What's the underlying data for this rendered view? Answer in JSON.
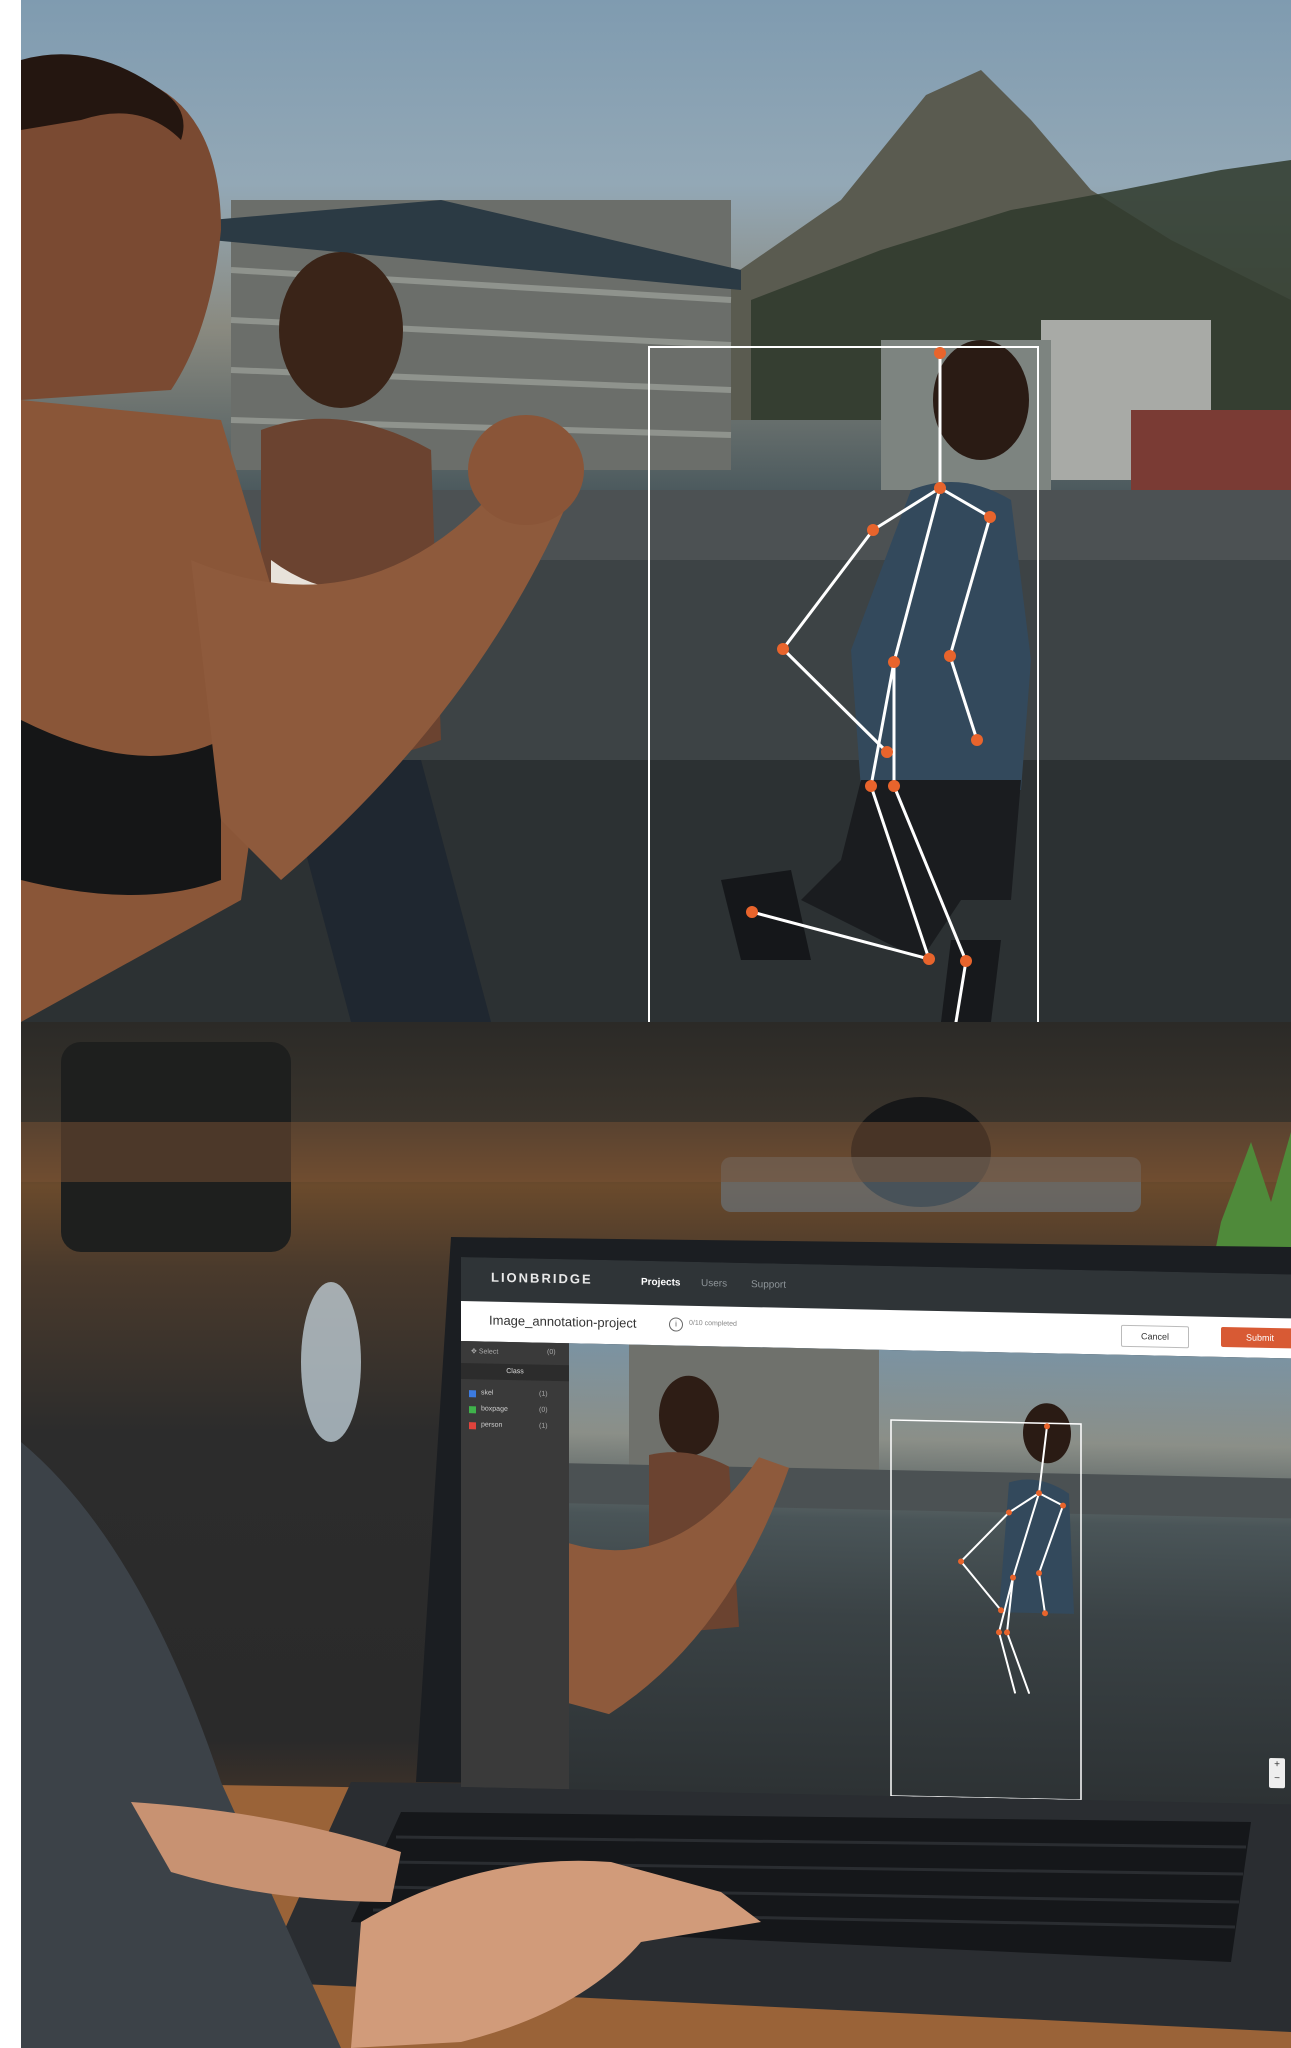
{
  "app": {
    "logo": "LIONBRIDGE",
    "tabs": [
      {
        "label": "Projects",
        "active": true
      },
      {
        "label": "Users",
        "active": false
      },
      {
        "label": "Support",
        "active": false
      }
    ],
    "project_title": "Image_annotation-project",
    "info_icon": "info-icon",
    "progress_text": "0/10 completed",
    "cancel_label": "Cancel",
    "submit_label": "Submit",
    "sidebar": {
      "select_label": "Select",
      "select_count": "(0)",
      "class_header": "Class",
      "classes": [
        {
          "name": "skel",
          "count": "(1)",
          "color": "#3c7be0"
        },
        {
          "name": "boxpage",
          "count": "(0)",
          "color": "#3fb24b"
        },
        {
          "name": "person",
          "count": "(1)",
          "color": "#e0433c"
        }
      ]
    },
    "zoom_in": "+",
    "zoom_out": "−"
  },
  "colors": {
    "accent": "#d85a34",
    "keypoint": "#e8642c",
    "skeleton": "#ffffff",
    "topbar": "#2f3437"
  }
}
